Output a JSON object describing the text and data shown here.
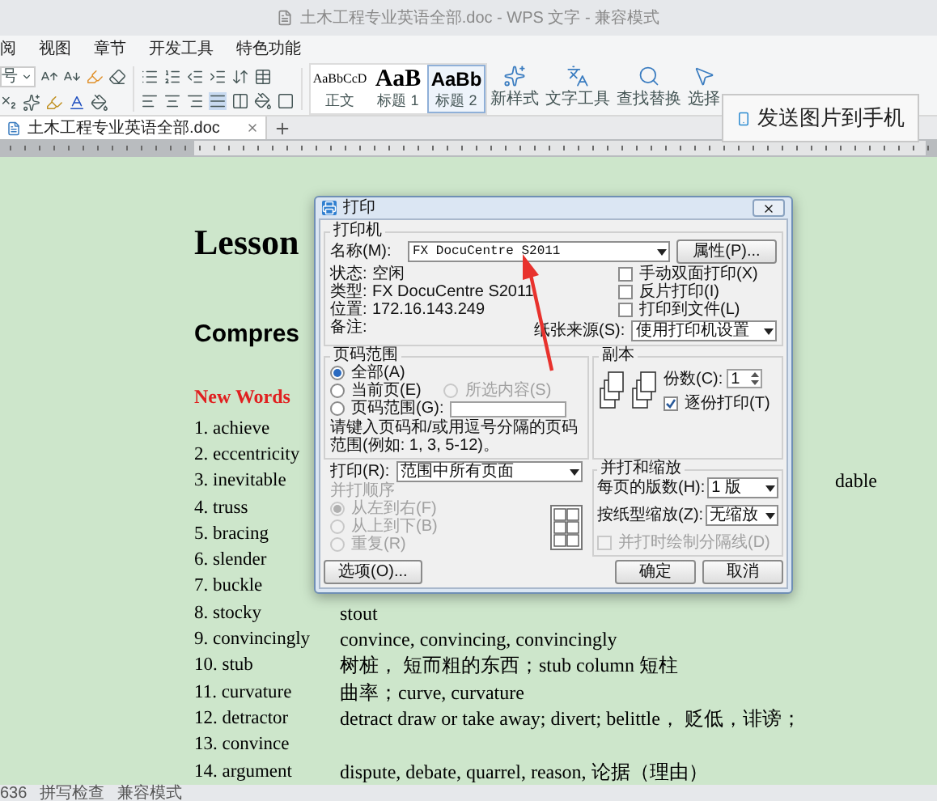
{
  "window": {
    "title": "土木工程专业英语全部.doc - WPS 文字 - 兼容模式"
  },
  "menu": [
    "阅",
    "视图",
    "章节",
    "开发工具",
    "特色功能"
  ],
  "toolbar": {
    "font_size": "号",
    "styles": [
      {
        "preview": "AaBbCcD",
        "label": "正文",
        "selected": false,
        "kind": "plain"
      },
      {
        "preview": "AaB",
        "label": "标题 1",
        "selected": false,
        "kind": "big"
      },
      {
        "preview": "AaBb",
        "label": "标题 2",
        "selected": true,
        "kind": "bold"
      }
    ],
    "tools": [
      {
        "label": "新样式",
        "kind": "style"
      },
      {
        "label": "文字工具",
        "kind": "text"
      },
      {
        "label": "查找替换",
        "kind": "find"
      },
      {
        "label": "选择",
        "kind": "select"
      }
    ],
    "send_button": "发送图片到手机"
  },
  "doc_tab": {
    "label": "土木工程专业英语全部.doc"
  },
  "document": {
    "title": "Lesson",
    "subtitle": "Compres",
    "section": "New Words",
    "rows": [
      {
        "term": "1. achieve"
      },
      {
        "term": "2. eccentricity"
      },
      {
        "term": "3. inevitable",
        "meaning": "dable",
        "kind": "tail"
      },
      {
        "term": "4. truss"
      },
      {
        "term": "5. bracing"
      },
      {
        "term": "6. slender"
      },
      {
        "term": "7. buckle"
      },
      {
        "term": "8. stocky",
        "meaning": "stout",
        "kind": "full"
      },
      {
        "term": "9. convincingly",
        "meaning": "convince, convincing, convincingly",
        "kind": "full"
      },
      {
        "term": "10. stub",
        "meaning": "树桩，  短而粗的东西；stub column  短柱",
        "kind": "full"
      },
      {
        "term": "11. curvature",
        "meaning": "曲率；curve, curvature",
        "kind": "full"
      },
      {
        "term": "12. detractor",
        "meaning": "detract    draw or take away; divert; belittle，  贬低，诽谤；",
        "kind": "full"
      },
      {
        "term": "13. convince"
      },
      {
        "term": "14. argument",
        "meaning": "dispute, debate, quarrel, reason, 论据（理由）",
        "kind": "full"
      }
    ]
  },
  "status_bar": [
    "636",
    "拼写检查",
    "兼容模式"
  ],
  "dialog": {
    "title": "打印",
    "printer": {
      "title": "打印机",
      "name_label": "名称(M):",
      "name_value": "FX DocuCentre S2011",
      "properties_button": "属性(P)...",
      "info": [
        {
          "label": "状态:",
          "value": "空闲"
        },
        {
          "label": "类型:",
          "value": "FX DocuCentre S2011"
        },
        {
          "label": "位置:",
          "value": "172.16.143.249"
        },
        {
          "label": "备注:"
        }
      ],
      "checkboxes": [
        {
          "label": "手动双面打印(X)",
          "checked": false
        },
        {
          "label": "反片打印(I)",
          "checked": false
        },
        {
          "label": "打印到文件(L)",
          "checked": false
        }
      ],
      "paper_source_label": "纸张来源(S):",
      "paper_source_value": "使用打印机设置"
    },
    "page_range": {
      "title": "页码范围",
      "rows": [
        [
          {
            "label": "全部(A)",
            "selected": true,
            "disabled": false,
            "kind": "plain"
          }
        ],
        [
          {
            "label": "当前页(E)",
            "selected": false,
            "disabled": false,
            "kind": "plain"
          },
          {
            "label": "所选内容(S)",
            "selected": false,
            "disabled": true,
            "kind": "plain"
          }
        ],
        [
          {
            "label": "页码范围(G):",
            "selected": false,
            "disabled": false,
            "kind": "field"
          }
        ]
      ],
      "hint": "请键入页码和/或用逗号分隔的页码范围(例如: 1, 3, 5-12)。"
    },
    "print": {
      "label": "打印(R):",
      "value": "范围中所有页面"
    },
    "order": {
      "label": "并打顺序",
      "disabled": true,
      "options": [
        {
          "label": "从左到右(F)",
          "selected": true
        },
        {
          "label": "从上到下(B)",
          "selected": false
        },
        {
          "label": "重复(R)",
          "selected": false
        }
      ]
    },
    "copies": {
      "title": "副本",
      "label": "份数(C):",
      "value": "1",
      "collate": {
        "label": "逐份打印(T)",
        "checked": true
      }
    },
    "zoom": {
      "title": "并打和缩放",
      "per_page_label": "每页的版数(H):",
      "per_page_value": "1 版",
      "scale_label": "按纸型缩放(Z):",
      "scale_value": "无缩放",
      "divider": {
        "label": "并打时绘制分隔线(D)",
        "checked": false,
        "disabled": true
      }
    },
    "buttons": {
      "options": "选项(O)...",
      "ok": "确定",
      "cancel": "取消"
    }
  }
}
